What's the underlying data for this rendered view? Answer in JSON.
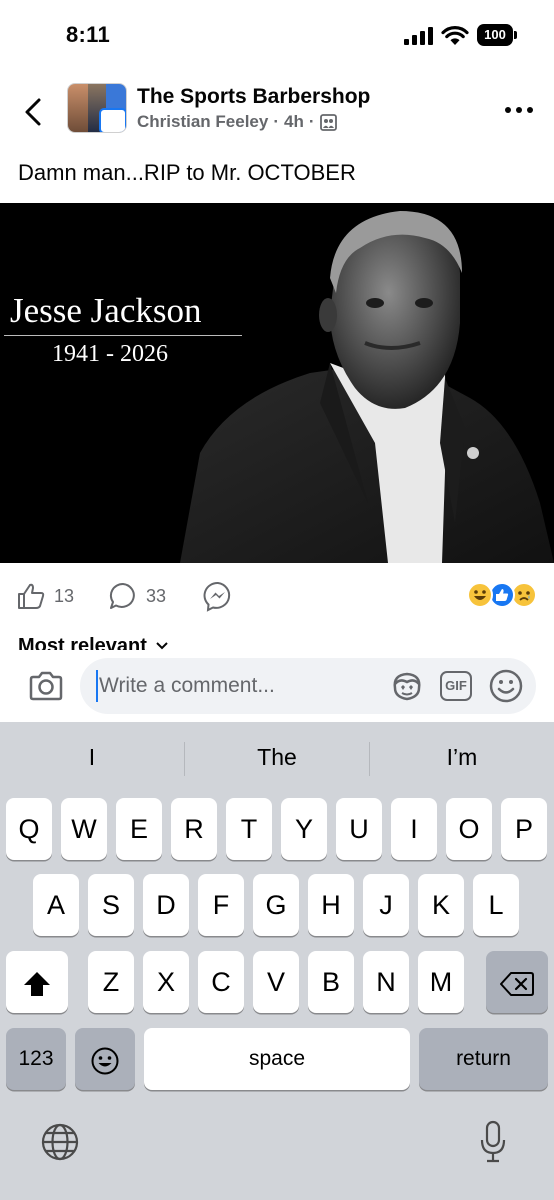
{
  "status_bar": {
    "time": "8:11",
    "battery": "100"
  },
  "header": {
    "group_name": "The Sports Barbershop",
    "author": "Christian Feeley",
    "time_ago": "4h",
    "separator": "·"
  },
  "post": {
    "text": "Damn man...RIP to Mr. OCTOBER",
    "image": {
      "name": "Jesse Jackson",
      "years": "1941 - 2026"
    }
  },
  "actions": {
    "likes": "13",
    "comments": "33",
    "reactions": [
      "laugh-reaction",
      "like-reaction",
      "sad-reaction"
    ]
  },
  "sort": {
    "label": "Most relevant"
  },
  "composer": {
    "placeholder": "Write a comment...",
    "value": ""
  },
  "keyboard": {
    "suggestions": [
      "I",
      "The",
      "I’m"
    ],
    "row1": [
      "Q",
      "W",
      "E",
      "R",
      "T",
      "Y",
      "U",
      "I",
      "O",
      "P"
    ],
    "row2": [
      "A",
      "S",
      "D",
      "F",
      "G",
      "H",
      "J",
      "K",
      "L"
    ],
    "row3": [
      "Z",
      "X",
      "C",
      "V",
      "B",
      "N",
      "M"
    ],
    "numbers_label": "123",
    "space_label": "space",
    "return_label": "return"
  },
  "colors": {
    "accent": "#1877f2",
    "muted": "#65676b",
    "keyboard_bg": "#d1d4d9"
  }
}
